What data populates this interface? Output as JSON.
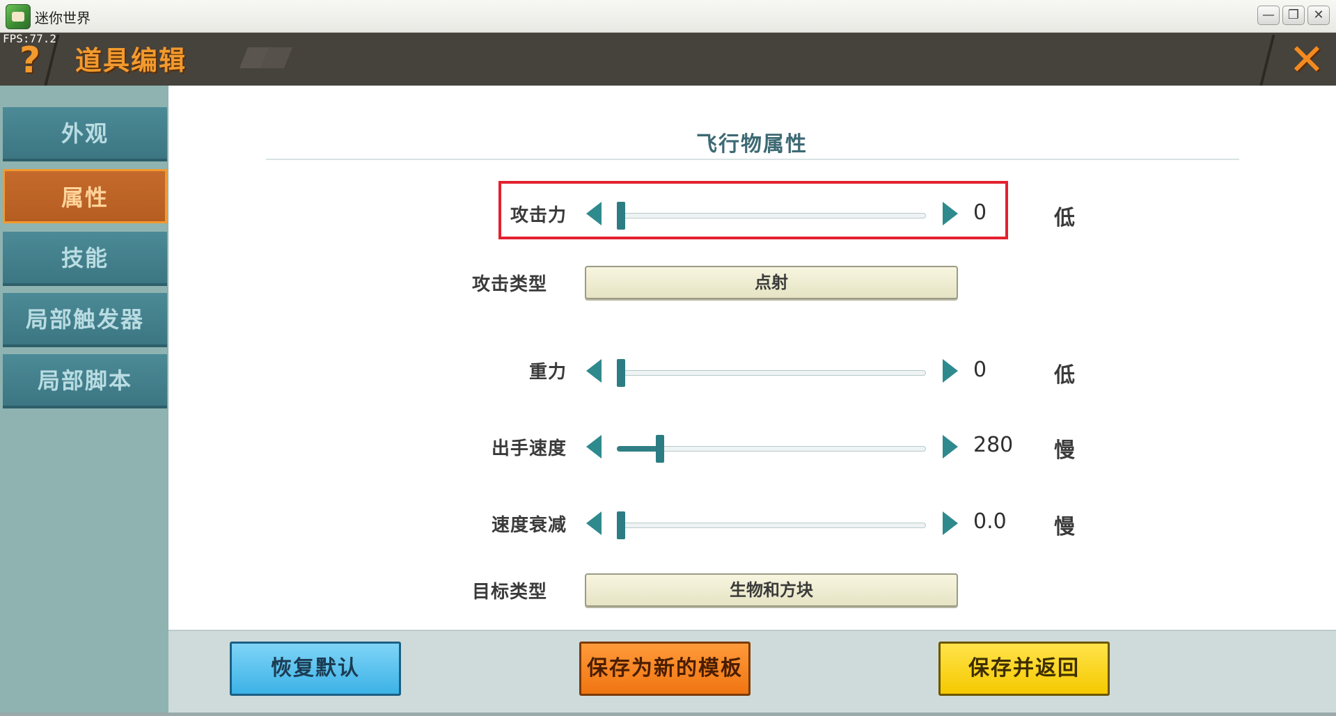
{
  "window": {
    "title": "迷你世界",
    "controls": {
      "minimize": "—",
      "restore": "❐",
      "close": "✕"
    }
  },
  "header": {
    "fps": "FPS:77.2",
    "help_symbol": "?",
    "title": "道具编辑",
    "close_symbol": "✕"
  },
  "sidebar": {
    "items": [
      {
        "label": "外观",
        "active": false
      },
      {
        "label": "属性",
        "active": true
      },
      {
        "label": "技能",
        "active": false
      },
      {
        "label": "局部触发器",
        "active": false
      },
      {
        "label": "局部脚本",
        "active": false
      }
    ]
  },
  "content": {
    "section_title": "飞行物属性",
    "rows": {
      "attack": {
        "label": "攻击力",
        "value": "0",
        "unit": "低",
        "fraction": 0.0
      },
      "attack_type": {
        "label": "攻击类型",
        "value": "点射"
      },
      "gravity": {
        "label": "重力",
        "value": "0",
        "unit": "低",
        "fraction": 0.0
      },
      "throw_speed": {
        "label": "出手速度",
        "value": "280",
        "unit": "慢",
        "fraction": 0.14
      },
      "speed_decay": {
        "label": "速度衰减",
        "value": "0.0",
        "unit": "慢",
        "fraction": 0.0
      },
      "target_type": {
        "label": "目标类型",
        "value": "生物和方块"
      }
    }
  },
  "buttons": {
    "reset": "恢复默认",
    "save_template": "保存为新的模板",
    "save_return": "保存并返回"
  },
  "colors": {
    "accent_orange": "#f29a2e",
    "teal": "#2f8a8e",
    "highlight_red": "#e3212f"
  }
}
